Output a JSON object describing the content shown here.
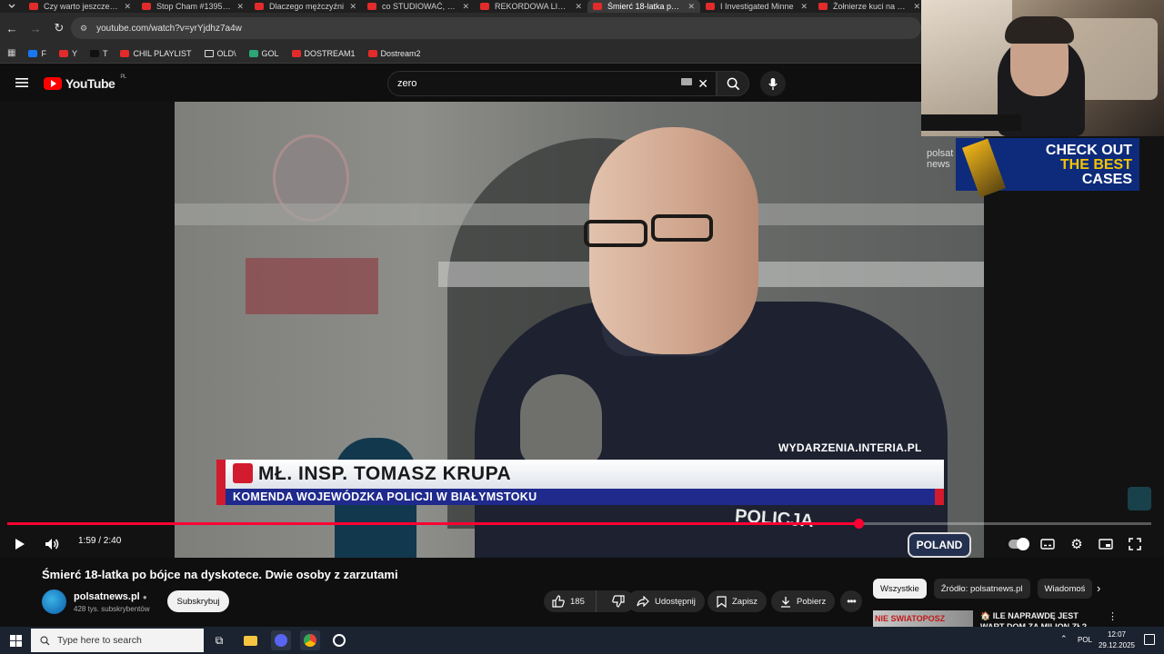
{
  "browser": {
    "tabs": [
      {
        "title": "Czy warto jeszcze inw"
      },
      {
        "title": "Stop Cham #1395 - N"
      },
      {
        "title": "Dlaczego mężczyźni"
      },
      {
        "title": "co STUDIOWAĆ, żeby"
      },
      {
        "title": "REKORDOWA LICZBA"
      },
      {
        "title": "Śmierć 18-latka po b"
      },
      {
        "title": "I Investigated Minne"
      },
      {
        "title": "Żołnierze kuci na czte"
      }
    ],
    "active_tab_index": 5,
    "url": "youtube.com/watch?v=yrYjdhz7a4w",
    "bookmarks": [
      {
        "label": "F"
      },
      {
        "label": "Y"
      },
      {
        "label": "T"
      },
      {
        "label": "CHIL PLAYLIST"
      },
      {
        "label": "OLD\\"
      },
      {
        "label": "GOL"
      },
      {
        "label": "DOSTREAM1"
      },
      {
        "label": "Dostream2"
      }
    ]
  },
  "youtube": {
    "logo_text": "YouTube",
    "region": "PL",
    "search_value": "zero"
  },
  "video": {
    "lower_third_name": "MŁ. INSP. TOMASZ KRUPA",
    "lower_third_org": "KOMENDA WOJEWÓDZKA POLICJI W BIAŁYMSTOKU",
    "source_watermark": "WYDARZENIA.INTERIA.PL",
    "jacket_text_1": "POLICJA",
    "jacket_text_2": "POLAND",
    "current_time": "1:59",
    "duration": "2:40",
    "time_display": "1:59 / 2:40",
    "progress_fraction": 0.744
  },
  "overlay": {
    "ad_line1": "CHECK OUT",
    "ad_line2": "THE BEST",
    "ad_line3": "CASES",
    "polsat_logo_l1": "polsat",
    "polsat_logo_l2": "news"
  },
  "meta": {
    "title": "Śmierć 18-latka po bójce na dyskotece. Dwie osoby z zarzutami",
    "channel": "polsatnews.pl",
    "subscribers": "428 tys. subskrybentów",
    "subscribe_label": "Subskrybuj",
    "likes": "185",
    "share_label": "Udostępnij",
    "save_label": "Zapisz",
    "download_label": "Pobierz"
  },
  "sidebar": {
    "chips": [
      "Wszystkie",
      "Źródło: polsatnews.pl",
      "Wiadomoś"
    ],
    "rec_title": "🏠 ILE NAPRAWDĘ JEST WART DOM ZA MILION ZŁ? 🔥 (RYN",
    "rec_thumb_text": "NIE SWIATOPOSZ"
  },
  "taskbar": {
    "search_placeholder": "Type here to search",
    "lang": "POL",
    "time": "12:07",
    "date": "29.12.2025"
  },
  "colors": {
    "youtube_red": "#ff0000",
    "progress_red": "#ff0033",
    "lower_third_blue": "#1f2a8c",
    "lower_third_red": "#d21b2e",
    "ad_blue": "#0d2b7a",
    "ad_yellow": "#f5c400"
  }
}
